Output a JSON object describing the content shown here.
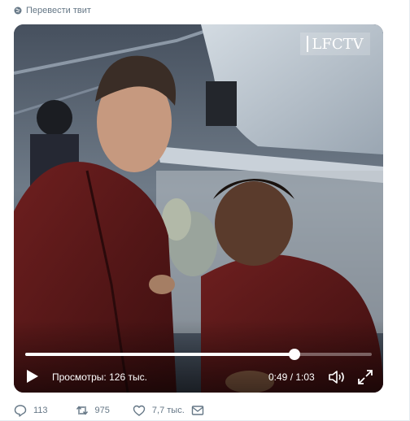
{
  "translate": {
    "label": "Перевести твит",
    "icon": "globe-icon"
  },
  "video": {
    "logo_text": "LFCTV",
    "views_text": "Просмотры: 126 тыс.",
    "time_text": "0:49 / 1:03",
    "progress": 0.778,
    "accent": "#ffffff"
  },
  "actions": {
    "reply_count": "113",
    "retweet_count": "975",
    "like_count": "7,7 тыс.",
    "reply_icon": "reply-icon",
    "retweet_icon": "retweet-icon",
    "like_icon": "heart-icon",
    "message_icon": "envelope-icon"
  },
  "colors": {
    "muted": "#657786"
  }
}
